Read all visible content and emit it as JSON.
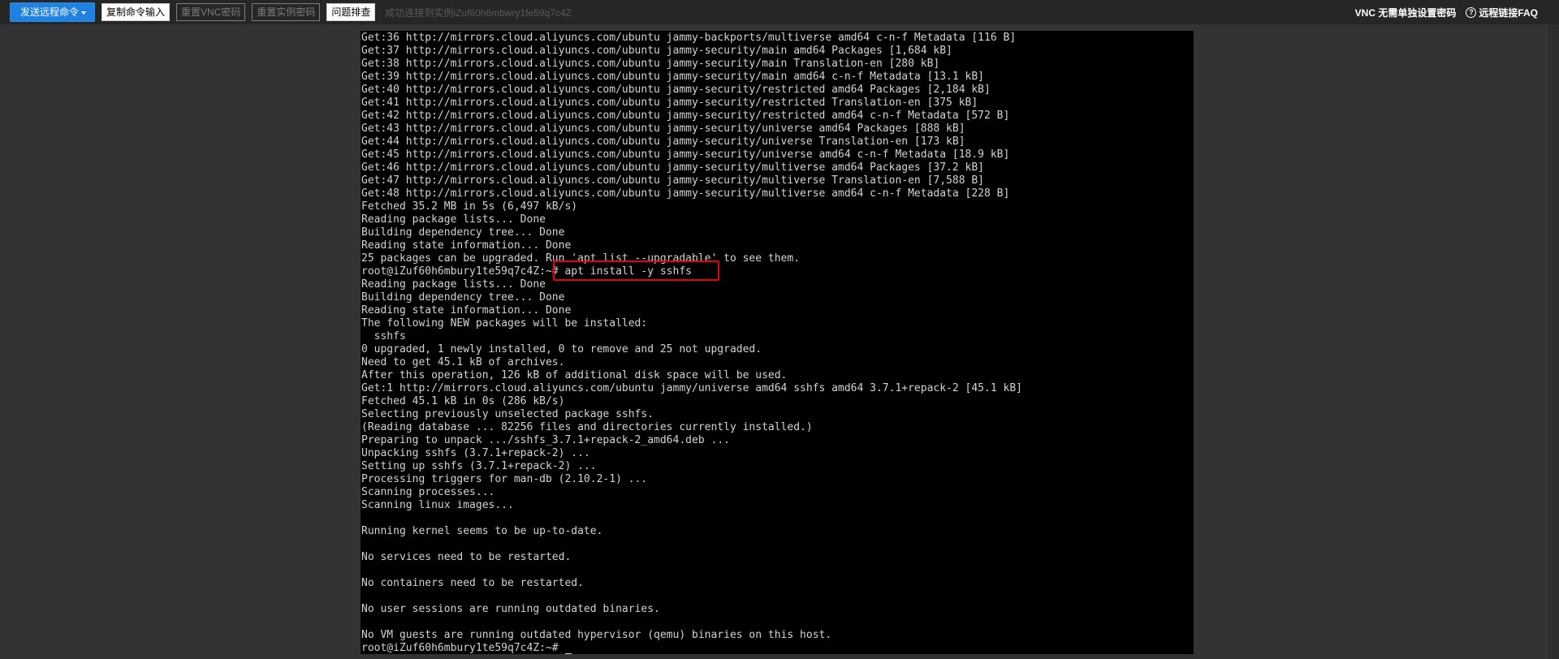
{
  "toolbar": {
    "send_command_label": "发送远程命令",
    "copy_command_label": "复制命令输入",
    "reset_vnc_label": "重置VNC密码",
    "reset_instance_label": "重置实例密码",
    "troubleshoot_label": "问题排查",
    "status_message": "成功连接到实例iZuf60h6mbwry1fe59q7c4Z",
    "vnc_no_password_link": "VNC 无需单独设置密码",
    "remote_faq_link": "远程链接FAQ"
  },
  "icons": {
    "caret": "chevron-down-icon",
    "help": "question-circle-icon"
  },
  "colors": {
    "accent": "#1f82e0",
    "highlight": "#e8000b",
    "terminal_bg": "#000000",
    "terminal_fg": "#d3d3d3"
  },
  "terminal": {
    "lines": [
      "Get:36 http://mirrors.cloud.aliyuncs.com/ubuntu jammy-backports/multiverse amd64 c-n-f Metadata [116 B]",
      "Get:37 http://mirrors.cloud.aliyuncs.com/ubuntu jammy-security/main amd64 Packages [1,684 kB]",
      "Get:38 http://mirrors.cloud.aliyuncs.com/ubuntu jammy-security/main Translation-en [280 kB]",
      "Get:39 http://mirrors.cloud.aliyuncs.com/ubuntu jammy-security/main amd64 c-n-f Metadata [13.1 kB]",
      "Get:40 http://mirrors.cloud.aliyuncs.com/ubuntu jammy-security/restricted amd64 Packages [2,184 kB]",
      "Get:41 http://mirrors.cloud.aliyuncs.com/ubuntu jammy-security/restricted Translation-en [375 kB]",
      "Get:42 http://mirrors.cloud.aliyuncs.com/ubuntu jammy-security/restricted amd64 c-n-f Metadata [572 B]",
      "Get:43 http://mirrors.cloud.aliyuncs.com/ubuntu jammy-security/universe amd64 Packages [888 kB]",
      "Get:44 http://mirrors.cloud.aliyuncs.com/ubuntu jammy-security/universe Translation-en [173 kB]",
      "Get:45 http://mirrors.cloud.aliyuncs.com/ubuntu jammy-security/universe amd64 c-n-f Metadata [18.9 kB]",
      "Get:46 http://mirrors.cloud.aliyuncs.com/ubuntu jammy-security/multiverse amd64 Packages [37.2 kB]",
      "Get:47 http://mirrors.cloud.aliyuncs.com/ubuntu jammy-security/multiverse Translation-en [7,588 B]",
      "Get:48 http://mirrors.cloud.aliyuncs.com/ubuntu jammy-security/multiverse amd64 c-n-f Metadata [228 B]",
      "Fetched 35.2 MB in 5s (6,497 kB/s)",
      "Reading package lists... Done",
      "Building dependency tree... Done",
      "Reading state information... Done",
      "25 packages can be upgraded. Run 'apt list --upgradable' to see them.",
      "root@iZuf60h6mbury1te59q7c4Z:~# apt install -y sshfs",
      "Reading package lists... Done",
      "Building dependency tree... Done",
      "Reading state information... Done",
      "The following NEW packages will be installed:",
      "  sshfs",
      "0 upgraded, 1 newly installed, 0 to remove and 25 not upgraded.",
      "Need to get 45.1 kB of archives.",
      "After this operation, 126 kB of additional disk space will be used.",
      "Get:1 http://mirrors.cloud.aliyuncs.com/ubuntu jammy/universe amd64 sshfs amd64 3.7.1+repack-2 [45.1 kB]",
      "Fetched 45.1 kB in 0s (286 kB/s)",
      "Selecting previously unselected package sshfs.",
      "(Reading database ... 82256 files and directories currently installed.)",
      "Preparing to unpack .../sshfs_3.7.1+repack-2_amd64.deb ...",
      "Unpacking sshfs (3.7.1+repack-2) ...",
      "Setting up sshfs (3.7.1+repack-2) ...",
      "Processing triggers for man-db (2.10.2-1) ...",
      "Scanning processes...",
      "Scanning linux images...",
      "",
      "Running kernel seems to be up-to-date.",
      "",
      "No services need to be restarted.",
      "",
      "No containers need to be restarted.",
      "",
      "No user sessions are running outdated binaries.",
      "",
      "No VM guests are running outdated hypervisor (qemu) binaries on this host.",
      "root@iZuf60h6mbury1te59q7c4Z:~# "
    ]
  }
}
